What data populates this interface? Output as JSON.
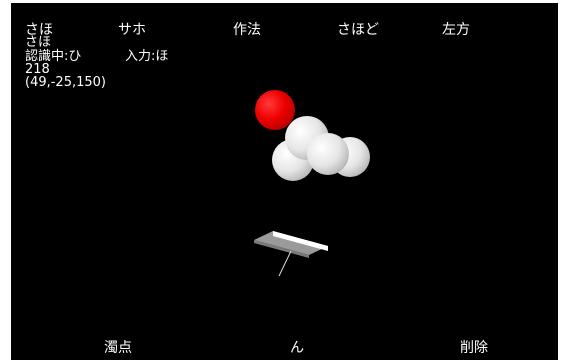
{
  "candidates": [
    "さほ",
    "サホ",
    "作法",
    "さほど",
    "左方"
  ],
  "status": {
    "current_text": "さほ",
    "recognition": "認識中:ひ",
    "input": "入力:ほ",
    "count": "218",
    "coords": "(49,-25,150)"
  },
  "bottom_buttons": {
    "dakuten": "濁点",
    "n": "ん",
    "delete": "削除"
  },
  "colors": {
    "background": "#000000",
    "text": "#ffffff",
    "fingertip": "#ff0000",
    "joint_sphere": "#e8e8e8"
  }
}
